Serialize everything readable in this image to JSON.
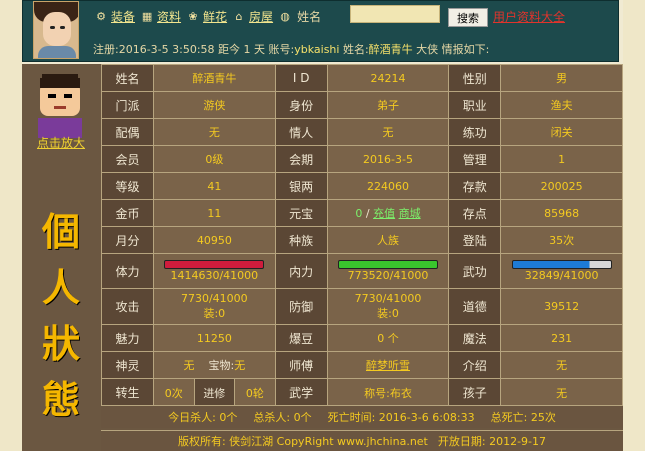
{
  "toolbar": {
    "equip": "装备",
    "info": "资料",
    "flower": "鲜花",
    "house": "房屋",
    "name_label": "姓名",
    "search": "搜索",
    "all_info": "用户资料大全"
  },
  "reg": {
    "prefix": "注册:2016-3-5 3:50:58 距今 1 天 账号:",
    "account": "ybkaishi",
    "name_prefix": " 姓名:",
    "name": "醉酒青牛",
    "suffix": " 大侠 情报如下:"
  },
  "left": {
    "zoom": "点击放大",
    "title_chars": [
      "個",
      "人",
      "狀",
      "態"
    ]
  },
  "rows": [
    [
      {
        "l": "姓名",
        "v": "醉酒青牛"
      },
      {
        "l": "I D",
        "v": "24214"
      },
      {
        "l": "性别",
        "v": "男"
      }
    ],
    [
      {
        "l": "门派",
        "v": "游侠"
      },
      {
        "l": "身份",
        "v": "弟子"
      },
      {
        "l": "职业",
        "v": "渔夫"
      }
    ],
    [
      {
        "l": "配偶",
        "v": "无"
      },
      {
        "l": "情人",
        "v": "无"
      },
      {
        "l": "练功",
        "v": "闭关"
      }
    ],
    [
      {
        "l": "会员",
        "v": "0级"
      },
      {
        "l": "会期",
        "v": "2016-3-5"
      },
      {
        "l": "管理",
        "v": "1"
      }
    ],
    [
      {
        "l": "等级",
        "v": "41"
      },
      {
        "l": "银两",
        "v": "224060"
      },
      {
        "l": "存款",
        "v": "200025"
      }
    ],
    [
      {
        "l": "金币",
        "v": "11"
      },
      {
        "l": "元宝",
        "v": ""
      },
      {
        "l": "存点",
        "v": "85968"
      }
    ],
    [
      {
        "l": "月分",
        "v": "40950"
      },
      {
        "l": "种族",
        "v": "人族"
      },
      {
        "l": "登陆",
        "v": "35次"
      }
    ]
  ],
  "yuanbao": {
    "count": "0",
    "sep": "/",
    "recharge": "充值",
    "mall": "商城"
  },
  "vitals": {
    "hp_label": "体力",
    "hp_text": "1414630/41000",
    "hp_fraction": 1.0,
    "mp_label": "内力",
    "mp_text": "773520/41000",
    "mp_fraction": 1.0,
    "wu_label": "武功",
    "wu_text": "32849/41000",
    "wu_fraction": 0.8
  },
  "attack": {
    "label": "攻击",
    "v1": "7730/41000",
    "v2": "装:0"
  },
  "defense": {
    "label": "防御",
    "v1": "7730/41000",
    "v2": "装:0"
  },
  "morality": {
    "label": "道德",
    "v": "39512"
  },
  "row_charm": [
    {
      "l": "魅力",
      "v": "11250"
    },
    {
      "l": "爆豆",
      "v": "0 个"
    },
    {
      "l": "魔法",
      "v": "231"
    }
  ],
  "row_spirit": {
    "l1": "神灵",
    "v1": "无",
    "sub1": "宝物:",
    "sub1v": "无",
    "l2": "师傅",
    "v2": "醉梦听雪",
    "l3": "介绍",
    "v3": "无"
  },
  "row_reborn": {
    "l1": "转生",
    "v1": "0次",
    "l1b": "进修",
    "v1b": "0轮",
    "l2": "武学",
    "v2": "称号:布衣",
    "l3": "孩子",
    "v3": "无"
  },
  "bottom": {
    "today_kill": "今日杀人: 0个",
    "total_kill": "总杀人: 0个",
    "death_time": "死亡时间: 2016-3-6 6:08:33",
    "total_death": "总死亡: 25次",
    "copyright": "版权所有: 侠剑江湖 CopyRight www.jhchina.net",
    "open_date": "开放日期: 2012-9-17"
  }
}
